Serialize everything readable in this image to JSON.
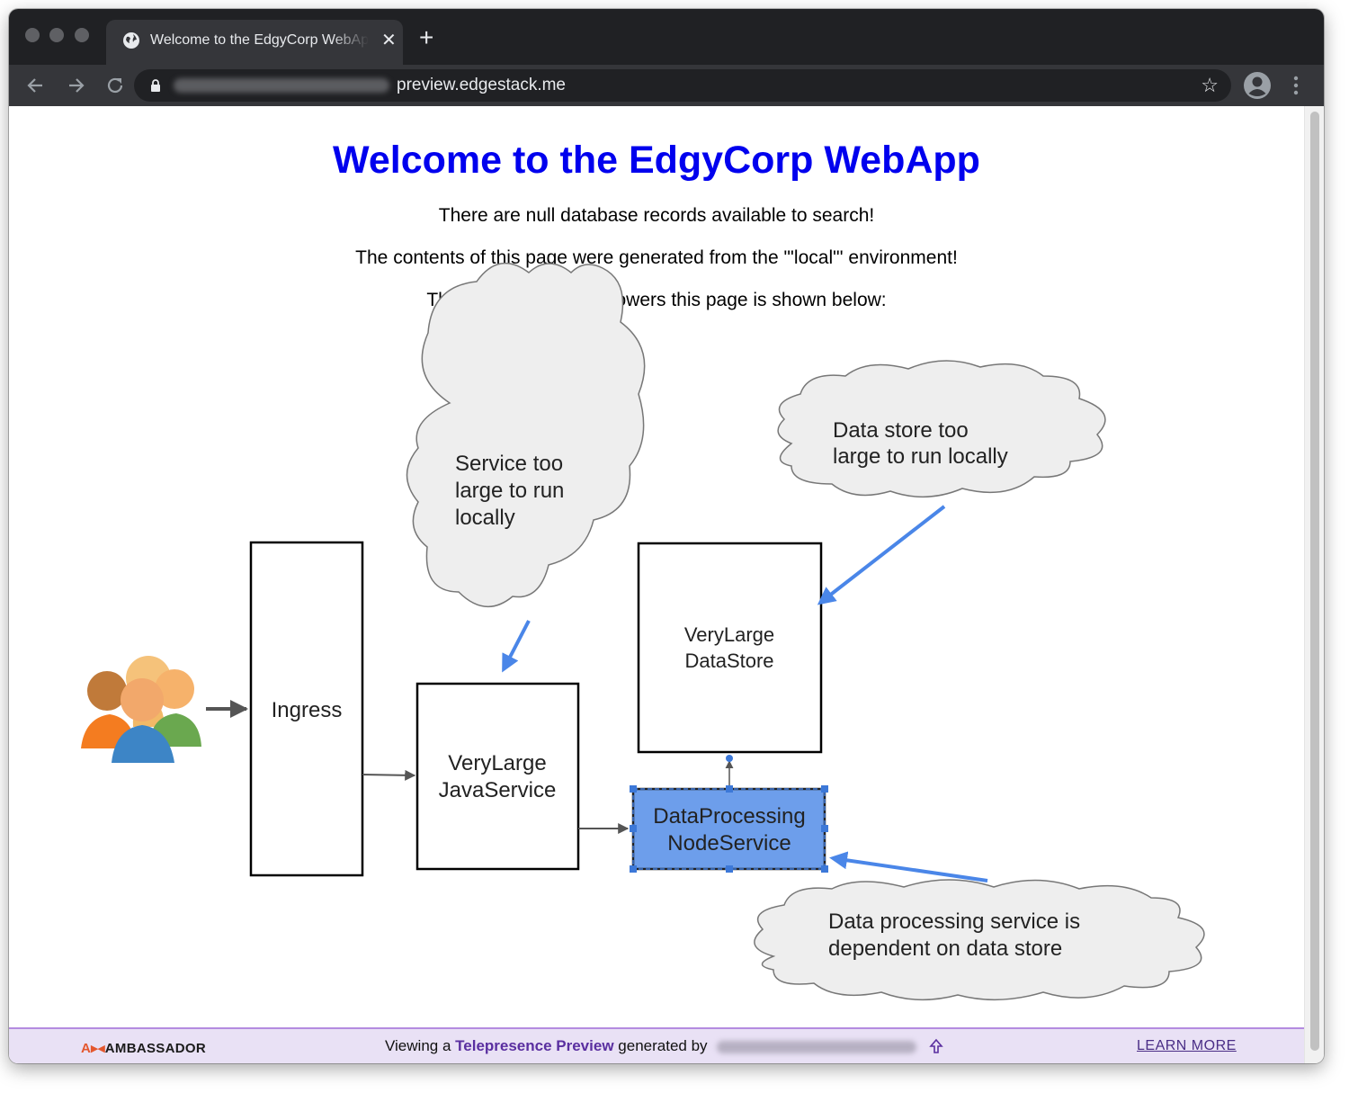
{
  "browser": {
    "tab_title": "Welcome to the EdgyCorp WebApp",
    "tab_close": "✕",
    "new_tab": "+",
    "url": "preview.edgestack.me",
    "bookmark_star": "☆",
    "icons": [
      "back-arrow-icon",
      "forward-arrow-icon",
      "reload-icon",
      "lock-icon",
      "star-icon",
      "profile-icon",
      "menu-kebab-icon",
      "globe-icon"
    ]
  },
  "page": {
    "heading": "Welcome to the EdgyCorp WebApp",
    "records_line": "There are null database records available to search!",
    "env_line": "The contents of this page were generated from the \"'local\"' environment!",
    "arch_line": "The architecture that powers this page is shown below:",
    "heading_color": "#0000ee"
  },
  "diagram": {
    "ingress_label": "Ingress",
    "java_service": [
      "VeryLarge",
      "JavaService"
    ],
    "data_store": [
      "VeryLarge",
      "DataStore"
    ],
    "node_service": [
      "DataProcessing",
      "NodeService"
    ],
    "cloud_service": [
      "Service too",
      "large to run",
      "locally"
    ],
    "cloud_datastore": [
      "Data store too",
      "large to run locally"
    ],
    "cloud_dependency": [
      "Data processing service is",
      "dependent on data store"
    ],
    "accent_blue": "#4a86e8",
    "selected_fill": "#6d9eeb"
  },
  "footer": {
    "brand": "AMBASSADOR",
    "viewing_prefix": "Viewing a",
    "link_text": "Telepresence Preview",
    "generated_by": "generated by",
    "learn_more": "LEARN MORE",
    "accent": "#5a2fa0"
  }
}
